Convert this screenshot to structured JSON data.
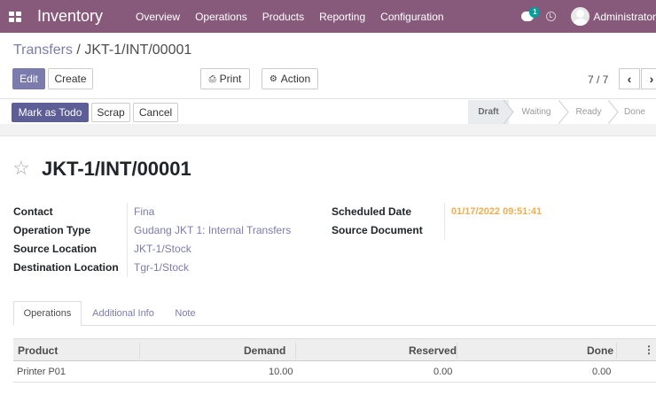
{
  "navbar": {
    "app_name": "Inventory",
    "menus": [
      "Overview",
      "Operations",
      "Products",
      "Reporting",
      "Configuration"
    ],
    "chat_count": "1",
    "user": "Administrator",
    "color": "#875a7b"
  },
  "breadcrumb": {
    "parent": "Transfers",
    "separator": " / ",
    "current": "JKT-1/INT/00001"
  },
  "toolbar": {
    "edit": "Edit",
    "create": "Create",
    "print": "Print",
    "action": "Action",
    "pager": "7 / 7"
  },
  "header_buttons": {
    "mark_todo": "Mark as Todo",
    "scrap": "Scrap",
    "cancel": "Cancel"
  },
  "stages": [
    {
      "label": "Draft",
      "active": true
    },
    {
      "label": "Waiting",
      "active": false
    },
    {
      "label": "Ready",
      "active": false
    },
    {
      "label": "Done",
      "active": false
    }
  ],
  "record": {
    "title": "JKT-1/INT/00001",
    "contact_label": "Contact",
    "contact": "Fina",
    "operation_type_label": "Operation Type",
    "operation_type": "Gudang JKT 1: Internal Transfers",
    "source_location_label": "Source Location",
    "source_location": "JKT-1/Stock",
    "destination_location_label": "Destination Location",
    "destination_location": "Tgr-1/Stock",
    "scheduled_date_label": "Scheduled Date",
    "scheduled_date": "01/17/2022 09:51:41",
    "source_document_label": "Source Document",
    "source_document": ""
  },
  "tabs": [
    "Operations",
    "Additional Info",
    "Note"
  ],
  "table": {
    "headers": {
      "product": "Product",
      "demand": "Demand",
      "reserved": "Reserved",
      "done": "Done"
    },
    "rows": [
      {
        "product": "Printer P01",
        "demand": "10.00",
        "reserved": "0.00",
        "done": "0.00"
      }
    ]
  },
  "colors": {
    "accent": "#7c7bad",
    "primary_dark": "#5d5e96",
    "warning": "#f0ad4e"
  }
}
